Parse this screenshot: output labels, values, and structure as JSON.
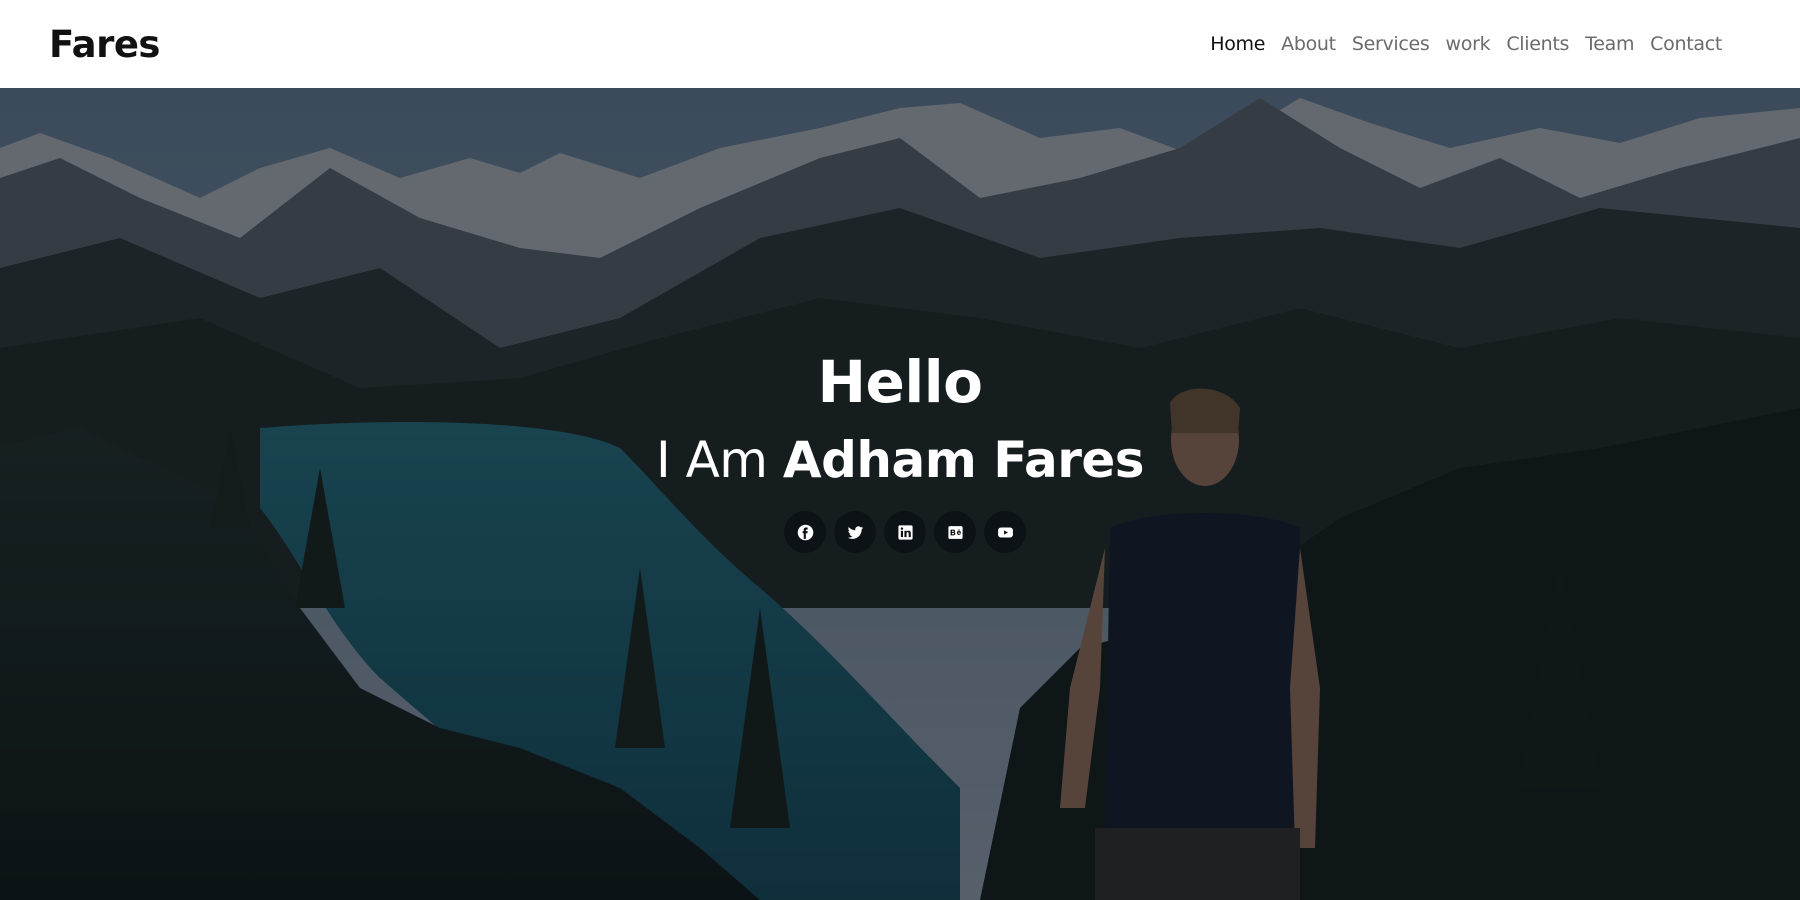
{
  "navbar": {
    "brand": "Fares",
    "links": [
      {
        "label": "Home",
        "active": true
      },
      {
        "label": "About"
      },
      {
        "label": "Services"
      },
      {
        "label": "work"
      },
      {
        "label": "Clients"
      },
      {
        "label": "Team"
      },
      {
        "label": "Contact"
      }
    ]
  },
  "hero": {
    "title": "Hello",
    "subtitle_prefix": "I Am",
    "subtitle_name": "Adham Fares",
    "socials": [
      {
        "icon": "facebook-icon"
      },
      {
        "icon": "twitter-icon"
      },
      {
        "icon": "linkedin-icon"
      },
      {
        "icon": "behance-icon"
      },
      {
        "icon": "youtube-icon"
      }
    ]
  },
  "colors": {
    "nav_background": "#ffffff",
    "nav_active": "#111111",
    "nav_link": "#6b6b6b",
    "hero_text": "#ffffff"
  }
}
